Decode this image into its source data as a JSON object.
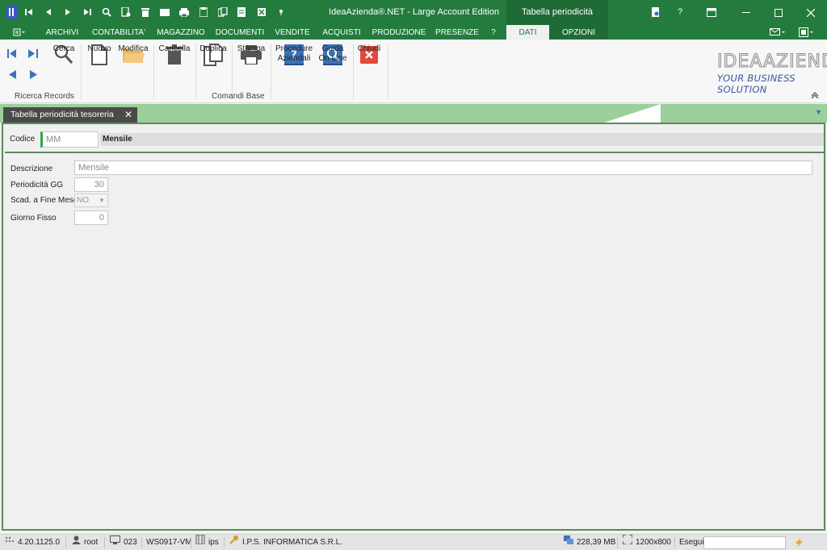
{
  "app": {
    "title": "IdeaAzienda®.NET - Large Account Edition",
    "context_tab_title": "Tabella periodicità tesoreria"
  },
  "menu": {
    "items": [
      "ARCHIVI",
      "CONTABILITA'",
      "MAGAZZINO",
      "DOCUMENTI",
      "VENDITE",
      "ACQUISTI",
      "PRODUZIONE",
      "PRESENZE",
      "?"
    ],
    "context_items": [
      "DATI",
      "OPZIONI"
    ]
  },
  "ribbon": {
    "cerca": "Cerca",
    "nuovo": "Nuovo",
    "modifica": "Modifica",
    "cancella": "Cancella",
    "duplica": "Duplica",
    "stampa": "Stampa",
    "procedure": "Procedure\nAziendali",
    "guida": "Guida\nOn Line",
    "chiudi": "Chiudi",
    "group_ricerca": "Ricerca Records",
    "group_comandi": "Comandi Base"
  },
  "logo": {
    "main": "IDEAAZIENDA",
    "sub": "YOUR BUSINESS SOLUTION"
  },
  "doc_tab": {
    "label": "Tabella periodicità tesoreria",
    "close": "✕"
  },
  "form": {
    "codice_label": "Codice",
    "codice_value": "MM",
    "codice_desc": "Mensile",
    "descrizione_label": "Descrizione",
    "descrizione_value": "Mensile",
    "periodicita_label": "Periodicità GG",
    "periodicita_value": "30",
    "scad_label": "Scad. a Fine Mese",
    "scad_value": "NO",
    "giorno_label": "Giorno Fisso",
    "giorno_value": "0"
  },
  "status": {
    "version": "4.20.1125.0",
    "user": "root",
    "terminal": "023",
    "workstation": "WS0917-VM",
    "db": "ips",
    "company": "I.P.S. INFORMATICA S.R.L.",
    "memory": "228,39 MB",
    "resolution": "1200x800",
    "esegui_label": "Esegui"
  },
  "colors": {
    "brand_green": "#237c3e",
    "strip_green": "#9bcf9b",
    "chiudi_red": "#e04a3a",
    "blue_icon": "#3a73b8"
  }
}
